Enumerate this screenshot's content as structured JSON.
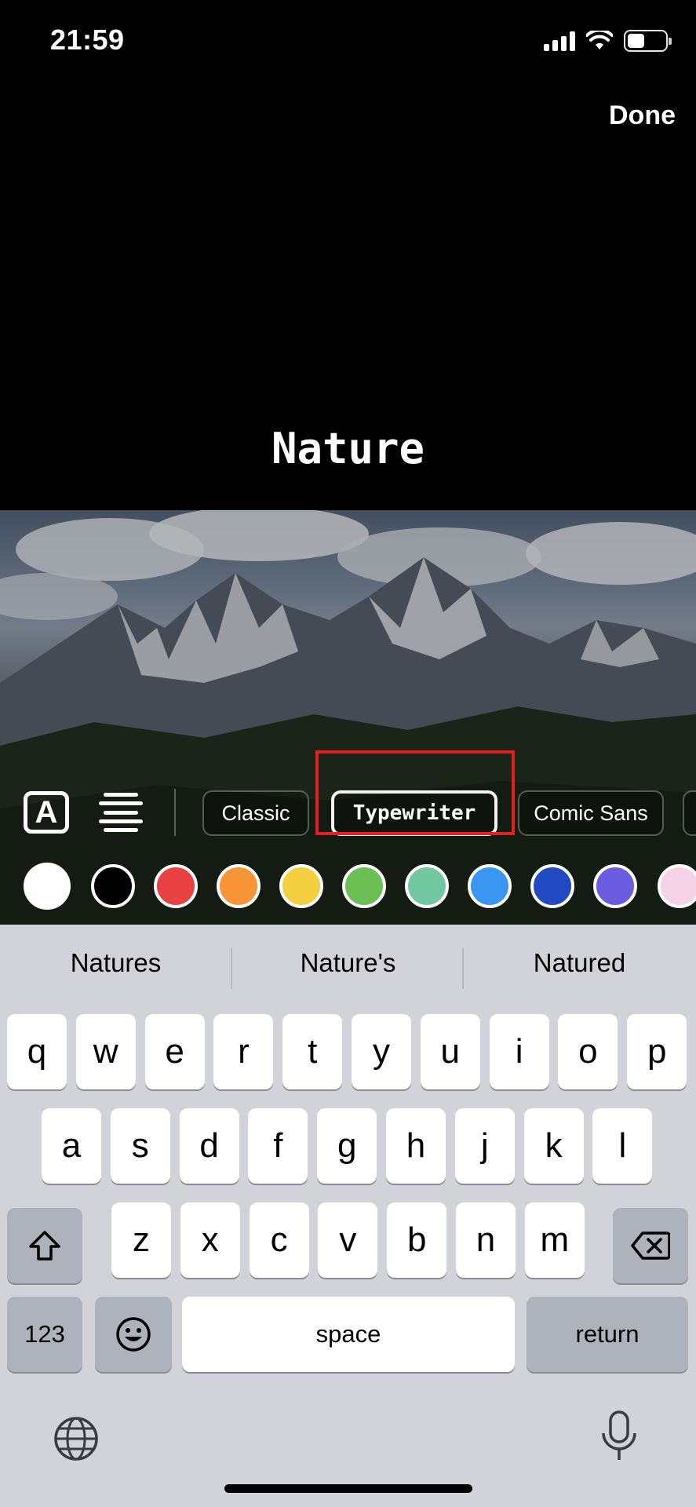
{
  "status": {
    "time": "21:59",
    "battery_level": 0.45
  },
  "header": {
    "done_label": "Done"
  },
  "canvas": {
    "text": "Nature"
  },
  "fonts": [
    {
      "label": "Classic",
      "selected": false
    },
    {
      "label": "Typewriter",
      "selected": true
    },
    {
      "label": "Comic Sans",
      "selected": false
    }
  ],
  "colors": [
    "#ffffff",
    "#000000",
    "#e84141",
    "#f79436",
    "#f4cf40",
    "#6bbf55",
    "#72c8a1",
    "#3b96f2",
    "#2149c2",
    "#6b5ce0",
    "#f5d2e5"
  ],
  "highlight_color": "#e32020",
  "keyboard": {
    "suggestions": [
      "Natures",
      "Nature's",
      "Natured"
    ],
    "row1": [
      "q",
      "w",
      "e",
      "r",
      "t",
      "y",
      "u",
      "i",
      "o",
      "p"
    ],
    "row2": [
      "a",
      "s",
      "d",
      "f",
      "g",
      "h",
      "j",
      "k",
      "l"
    ],
    "row3": [
      "z",
      "x",
      "c",
      "v",
      "b",
      "n",
      "m"
    ],
    "numbers_label": "123",
    "space_label": "space",
    "return_label": "return"
  }
}
